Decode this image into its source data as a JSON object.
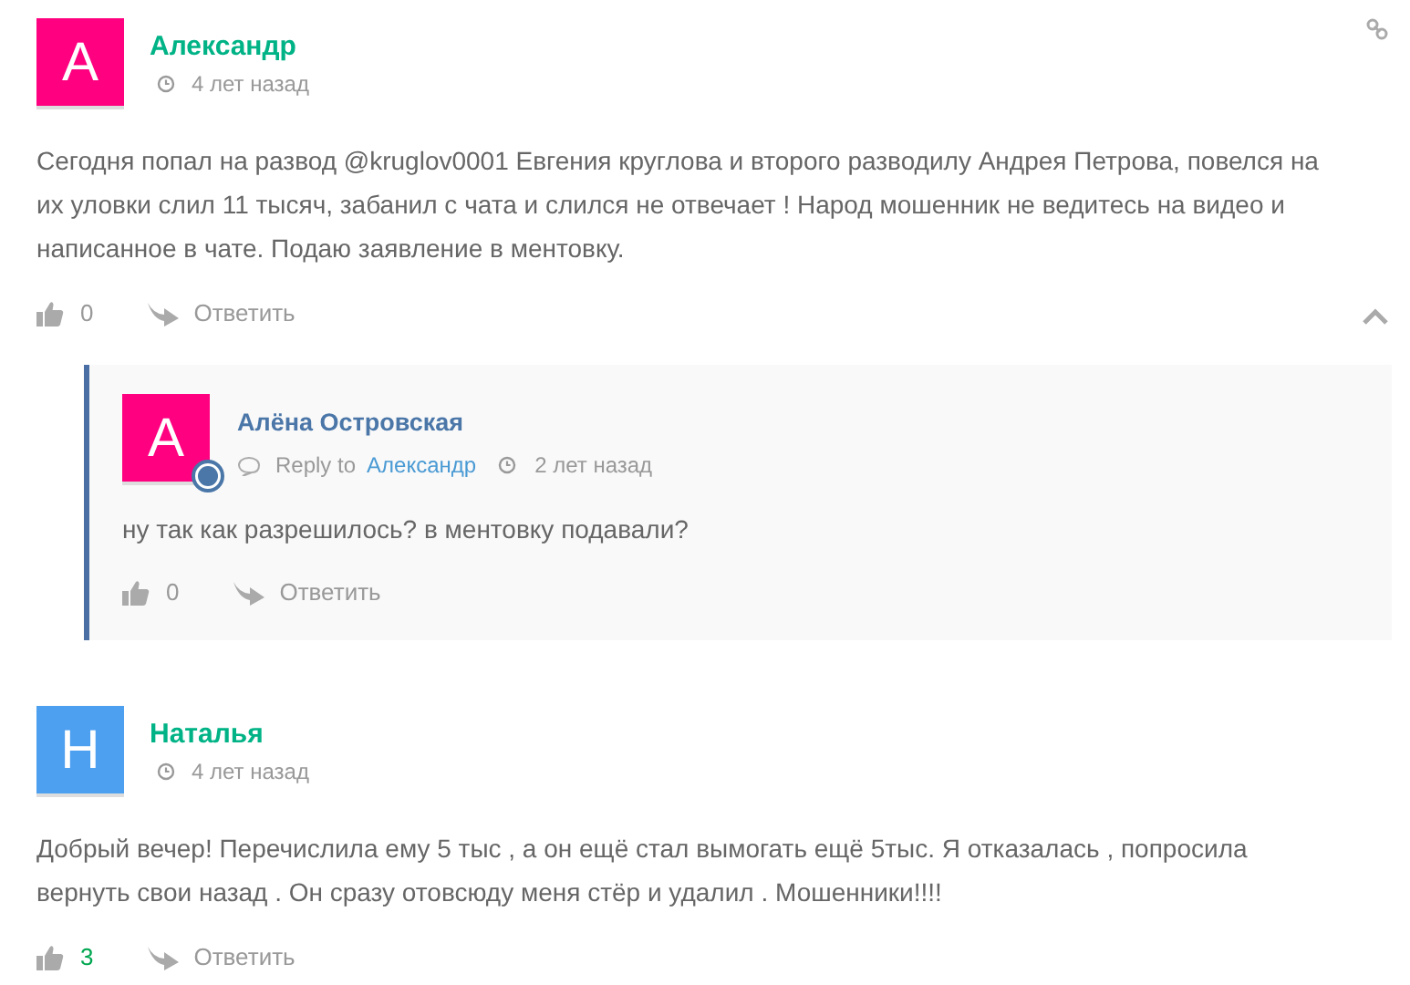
{
  "comments": [
    {
      "kind": "top",
      "initial": "А",
      "color": "#ff0080",
      "author": "Александр",
      "time": "4 лет назад",
      "text": "Сегодня попал на развод @kruglov0001 Евгения круглова и второго разводилу Андрея Петрова, повелся на их уловки слил 11 тысяч, забанил с чата и слился не отвечает ! Народ мошенник не ведитесь на видео и написанное в чате. Подаю заявление в ментовку.",
      "votes": "0",
      "votes_positive": false,
      "reply": "Ответить",
      "collapsible": true,
      "replies": [
        {
          "kind": "reply",
          "initial": "А",
          "color": "#ff0080",
          "author": "Алёна Островская",
          "reply_to_label": "Reply to",
          "reply_to": "Александр",
          "time": "2 лет назад",
          "text": "ну так как разрешилось? в ментовку подавали?",
          "votes": "0",
          "votes_positive": false,
          "reply": "Ответить"
        }
      ]
    },
    {
      "kind": "top",
      "initial": "Н",
      "color": "#4d9ff0",
      "author": "Наталья",
      "time": "4 лет назад",
      "text": "Добрый вечер! Перечислила ему 5 тыс , а он ещё стал вымогать ещё 5тыс. Я отказалась , попросила вернуть свои назад . Он сразу отовсюду меня стёр и удалил . Мошенники!!!!",
      "votes": "3",
      "votes_positive": true,
      "reply": "Ответить",
      "collapsible": false
    }
  ]
}
